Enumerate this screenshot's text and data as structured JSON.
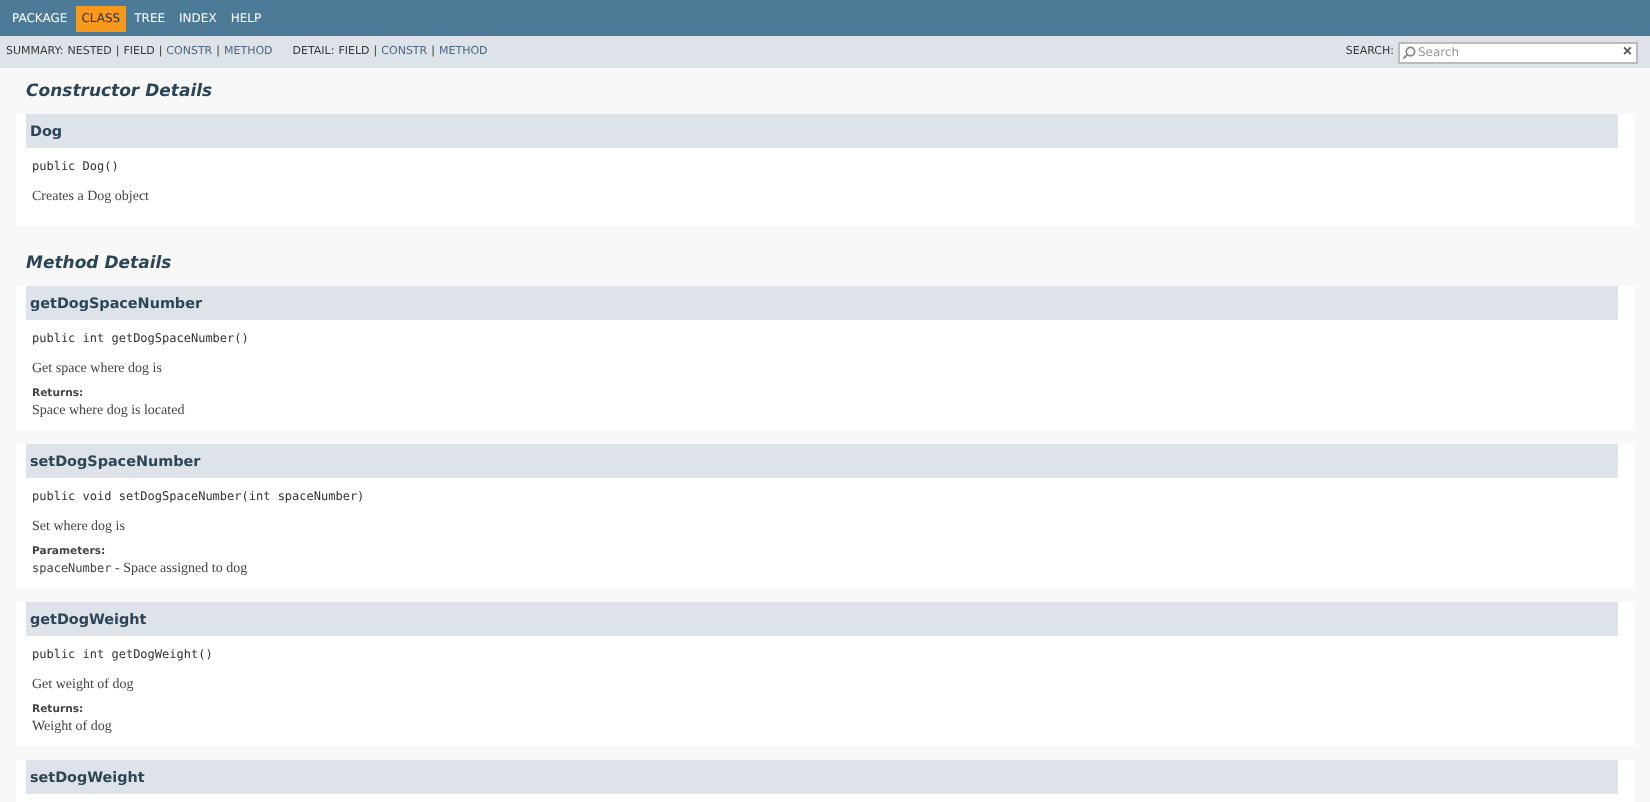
{
  "top_nav": [
    {
      "label": "PACKAGE",
      "selected": false
    },
    {
      "label": "CLASS",
      "selected": true
    },
    {
      "label": "TREE",
      "selected": false
    },
    {
      "label": "INDEX",
      "selected": false
    },
    {
      "label": "HELP",
      "selected": false
    }
  ],
  "sub_nav": {
    "summary_label": "SUMMARY:",
    "summary": [
      {
        "label": "NESTED",
        "link": false
      },
      {
        "label": "FIELD",
        "link": false
      },
      {
        "label": "CONSTR",
        "link": true
      },
      {
        "label": "METHOD",
        "link": true
      }
    ],
    "detail_label": "DETAIL:",
    "detail": [
      {
        "label": "FIELD",
        "link": false
      },
      {
        "label": "CONSTR",
        "link": true
      },
      {
        "label": "METHOD",
        "link": true
      }
    ],
    "separator": "|",
    "search_label": "SEARCH:",
    "search_placeholder": "Search",
    "clear": "×"
  },
  "sections": [
    {
      "title": "Constructor Details",
      "members": [
        {
          "name": "Dog",
          "signature": "public Dog()",
          "description": "Creates a Dog object"
        }
      ]
    },
    {
      "title": "Method Details",
      "members": [
        {
          "name": "getDogSpaceNumber",
          "signature": "public int getDogSpaceNumber()",
          "description": "Get space where dog is",
          "tags": [
            {
              "label": "Returns:",
              "text": "Space where dog is located"
            }
          ]
        },
        {
          "name": "setDogSpaceNumber",
          "signature": "public void setDogSpaceNumber(int spaceNumber)",
          "description": "Set where dog is",
          "tags": [
            {
              "label": "Parameters:",
              "param": "spaceNumber",
              "text": " - Space assigned to dog"
            }
          ]
        },
        {
          "name": "getDogWeight",
          "signature": "public int getDogWeight()",
          "description": "Get weight of dog",
          "tags": [
            {
              "label": "Returns:",
              "text": "Weight of dog"
            }
          ]
        },
        {
          "name": "setDogWeight"
        }
      ]
    }
  ]
}
